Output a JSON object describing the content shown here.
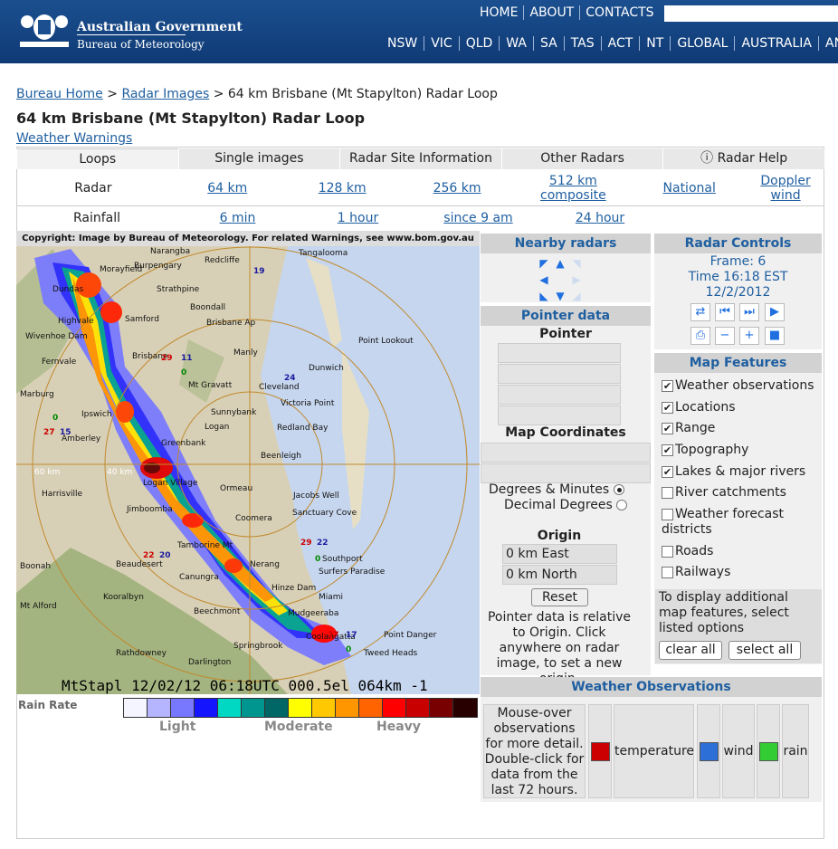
{
  "header": {
    "gov_line1": "Australian Government",
    "gov_line2": "Bureau of Meteorology",
    "top_links": [
      "HOME",
      "ABOUT",
      "CONTACTS"
    ],
    "region_links": [
      "NSW",
      "VIC",
      "QLD",
      "WA",
      "SA",
      "TAS",
      "ACT",
      "NT",
      "GLOBAL",
      "AUSTRALIA",
      "ANTA"
    ]
  },
  "breadcrumb": {
    "home": "Bureau Home",
    "sep1": " > ",
    "radar": "Radar Images",
    "sep2": " > ",
    "current": "64 km Brisbane (Mt Stapylton) Radar Loop"
  },
  "page_title": "64 km Brisbane (Mt Stapylton) Radar Loop",
  "warnings_link": "Weather Warnings",
  "tabs": [
    "Loops",
    "Single images",
    "Radar Site Information",
    "Other Radars",
    "ⓘ Radar Help"
  ],
  "radar_row": {
    "label": "Radar",
    "links": [
      "64 km",
      "128 km",
      "256 km",
      "512 km composite",
      "National",
      "Doppler wind"
    ]
  },
  "rainfall_row": {
    "label": "Rainfall",
    "links": [
      "6 min",
      "1 hour",
      "since 9 am",
      "24 hour"
    ]
  },
  "radar_image": {
    "copyright": "Copyright: Image by Bureau of Meteorology. For related Warnings, see www.bom.gov.au",
    "stamp": "MtStapl 12/02/12 06:18UTC 000.5el 064km -1",
    "ring_labels": [
      "60 km",
      "40 km"
    ],
    "places": [
      "Narangba",
      "Tangalooma",
      "Redcliffe",
      "Burpengary",
      "Morayfield",
      "Dundas",
      "Strathpine",
      "Boondall",
      "Samford",
      "Highvale",
      "Brisbane Ap",
      "Manly",
      "Point Lookout",
      "Wivenhoe Dam",
      "Fernvale",
      "Brisbane",
      "Dunwich",
      "Marburg",
      "Mt Gravatt",
      "Cleveland",
      "Victoria Point",
      "Ipswich",
      "Sunnybank",
      "Logan",
      "Redland Bay",
      "Amberley",
      "Greenbank",
      "Beenleigh",
      "Logan Village",
      "Ormeau",
      "Harrisville",
      "Jacobs Well",
      "Jimboomba",
      "Coomera",
      "Sanctuary Cove",
      "Tamborine Mt",
      "Southport",
      "Boonah",
      "Beaudesert",
      "Canungra",
      "Nerang",
      "Surfers Paradise",
      "Mt Alford",
      "Kooralbyn",
      "Hinze Dam",
      "Miami",
      "Beechmont",
      "Mudgeeraba",
      "Springbrook",
      "Coolangatta",
      "Point Danger",
      "Rathdowney",
      "Darlington",
      "Tweed Heads"
    ],
    "obs_numbers": [
      "19",
      "29",
      "11",
      "0",
      "24",
      "27",
      "15",
      "0",
      "22",
      "20",
      "29",
      "22",
      "0",
      "27",
      "17",
      "0"
    ]
  },
  "rain_rate": {
    "label": "Rain Rate",
    "colors": [
      "#f5f5ff",
      "#b4b4ff",
      "#7878ff",
      "#1414ff",
      "#00d8c3",
      "#009690",
      "#006666",
      "#ffff00",
      "#ffc800",
      "#ff9600",
      "#ff6400",
      "#ff0000",
      "#c80000",
      "#780000",
      "#280000"
    ],
    "light": "Light",
    "moderate": "Moderate",
    "heavy": "Heavy"
  },
  "nearby": {
    "title": "Nearby radars"
  },
  "pointer": {
    "title": "Pointer data",
    "pointer_label": "Pointer",
    "map_coords": "Map Coordinates",
    "opt_degmin": "Degrees & Minutes",
    "opt_decimal": "Decimal Degrees",
    "origin": "Origin",
    "east": "0 km East",
    "north": "0 km North",
    "reset": "Reset",
    "note": "Pointer data is relative to Origin. Click anywhere on radar image, to set a new origin."
  },
  "controls": {
    "title": "Radar Controls",
    "frame": "Frame: 6",
    "time": "Time 16:18 EST",
    "date": "12/2/2012"
  },
  "map_features": {
    "title": "Map Features",
    "items": [
      {
        "label": "Weather observations",
        "checked": true
      },
      {
        "label": "Locations",
        "checked": true
      },
      {
        "label": "Range",
        "checked": true
      },
      {
        "label": "Topography",
        "checked": true
      },
      {
        "label": "Lakes & major rivers",
        "checked": true
      },
      {
        "label": "River catchments",
        "checked": false
      },
      {
        "label": "Weather forecast districts",
        "checked": false
      },
      {
        "label": "Roads",
        "checked": false
      },
      {
        "label": "Railways",
        "checked": false
      }
    ],
    "note": "To display additional map features, select listed options",
    "clear_all": "clear all",
    "select_all": "select all"
  },
  "observations": {
    "title": "Weather Observations",
    "note": "Mouse-over observations for more detail. Double-click for data from the last 72 hours.",
    "temp": "temperature",
    "wind": "wind",
    "rain": "rain",
    "temp_color": "#cc0000",
    "wind_color": "#2c6fd6",
    "rain_color": "#33cc33"
  }
}
